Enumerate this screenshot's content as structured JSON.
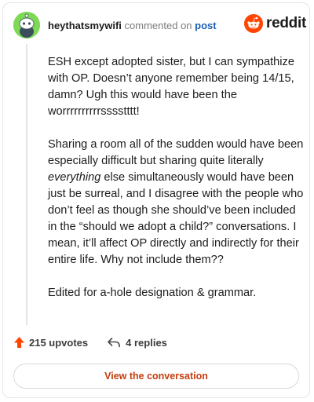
{
  "header": {
    "username": "heythatsmywifi",
    "action_text": "commented on",
    "post_label": "post",
    "brand": "reddit"
  },
  "comment": {
    "paragraphs": [
      {
        "segments": [
          {
            "text": "ESH except adopted sister, but I can sympathize with OP. Doesn’t anyone remember being 14/15, damn? Ugh this would have been the worrrrrrrrrrsssstttt!",
            "italic": false
          }
        ]
      },
      {
        "segments": [
          {
            "text": "Sharing a room all of the sudden would have been especially difficult but sharing quite literally ",
            "italic": false
          },
          {
            "text": "everything",
            "italic": true
          },
          {
            "text": " else simultaneously would have been just be surreal, and I disagree with the people who don’t feel as though she should’ve been included in the “should we adopt a child?” conversations. I mean, it’ll affect OP directly and indirectly for their entire life. Why not include them??",
            "italic": false
          }
        ]
      },
      {
        "segments": [
          {
            "text": "Edited for a-hole designation & grammar.",
            "italic": false
          }
        ]
      }
    ]
  },
  "footer": {
    "upvotes_label": "215 upvotes",
    "replies_label": "4 replies",
    "cta_label": "View the conversation"
  },
  "colors": {
    "avatar_bg": "#7ed957",
    "brand_orange": "#ff4500",
    "upvote": "#ff4500",
    "link": "#1a5fb4",
    "cta_text": "#c63d0f"
  },
  "icons": {
    "avatar": "snoo-avatar-icon",
    "brand": "reddit-logo-icon",
    "upvote": "upvote-arrow-icon",
    "reply": "reply-arrow-icon"
  }
}
